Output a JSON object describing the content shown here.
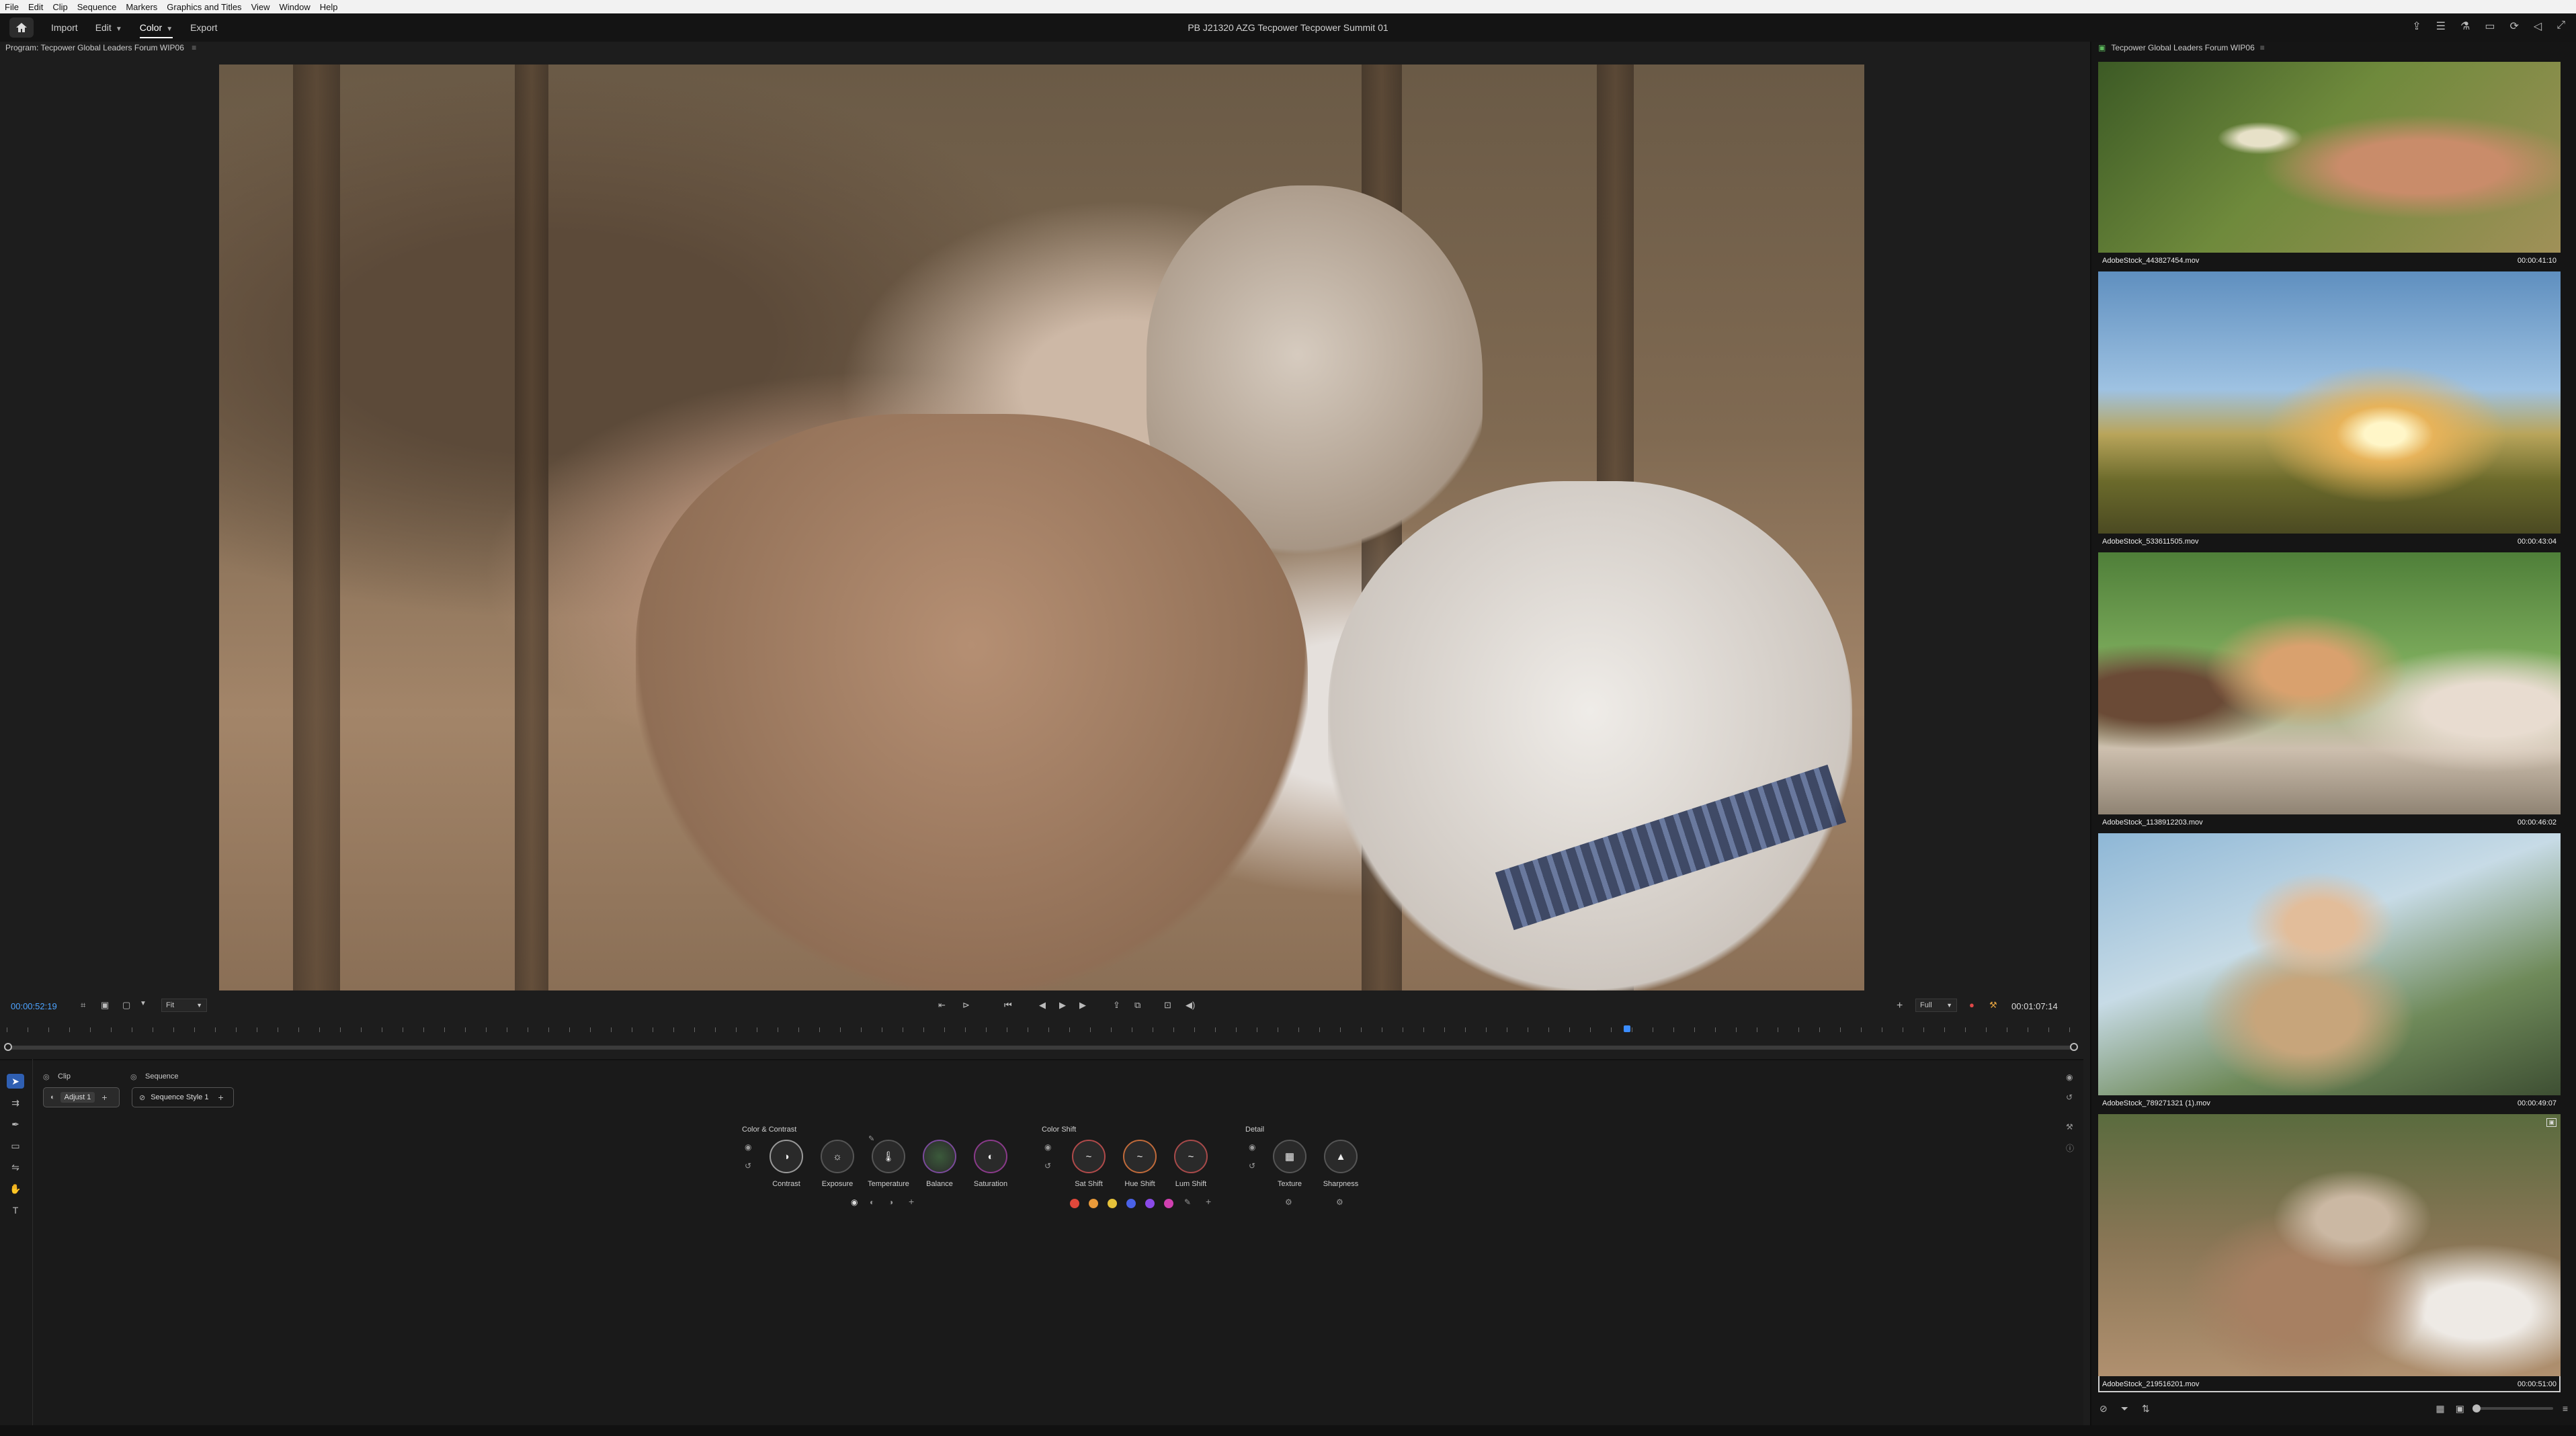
{
  "os_menu": [
    "File",
    "Edit",
    "Clip",
    "Sequence",
    "Markers",
    "Graphics and Titles",
    "View",
    "Window",
    "Help"
  ],
  "header": {
    "workspaces": [
      {
        "label": "Import",
        "active": false,
        "dropdown": false
      },
      {
        "label": "Edit",
        "active": false,
        "dropdown": true
      },
      {
        "label": "Color",
        "active": true,
        "dropdown": true
      },
      {
        "label": "Export",
        "active": false,
        "dropdown": false
      }
    ],
    "title": "PB J21320 AZG Tecpower Tecpower Summit 01"
  },
  "program": {
    "tab_label": "Program: Tecpower Global Leaders Forum WIP06",
    "timecode_current": "00:00:52:19",
    "timecode_duration": "00:01:07:14",
    "fit_label": "Fit",
    "quality_label": "Full",
    "playhead_fraction": 0.78
  },
  "color_panel": {
    "tabs": [
      "Clip",
      "Sequence"
    ],
    "adjust_label": "Adjust 1",
    "sequence_style_label": "Sequence Style 1",
    "sections": {
      "contrast": {
        "title": "Color & Contrast",
        "dials": [
          "Contrast",
          "Exposure",
          "Temperature",
          "Balance",
          "Saturation"
        ]
      },
      "shift": {
        "title": "Color Shift",
        "dials": [
          "Sat Shift",
          "Hue Shift",
          "Lum Shift"
        ]
      },
      "detail": {
        "title": "Detail",
        "dials": [
          "Texture",
          "Sharpness"
        ]
      }
    },
    "swatches": [
      "#e0483b",
      "#e99a3a",
      "#e6c23a",
      "#4a62e8",
      "#8a4ae8",
      "#d040b0"
    ]
  },
  "right_panel": {
    "tab_label": "Tecpower Global Leaders Forum WIP06",
    "clips": [
      {
        "name": "AdobeStock_443827454.mov",
        "duration": "00:00:41:10"
      },
      {
        "name": "AdobeStock_533611505.mov",
        "duration": "00:00:43:04"
      },
      {
        "name": "AdobeStock_1138912203.mov",
        "duration": "00:00:46:02"
      },
      {
        "name": "AdobeStock_789271321 (1).mov",
        "duration": "00:00:49:07"
      },
      {
        "name": "AdobeStock_219516201.mov",
        "duration": "00:00:51:00"
      }
    ]
  }
}
